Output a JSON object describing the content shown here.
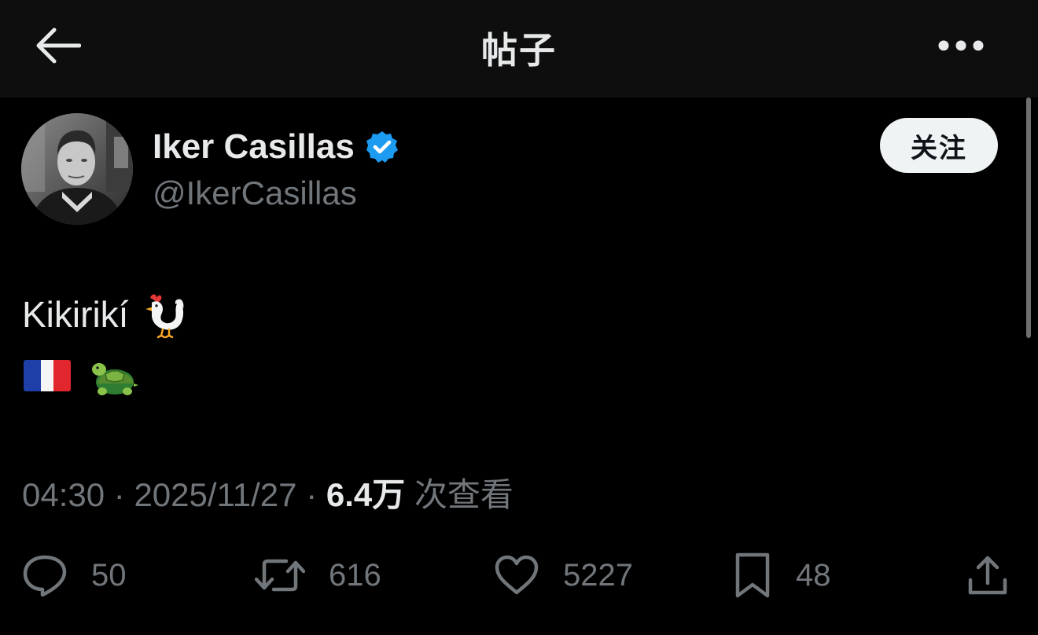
{
  "header": {
    "title": "帖子",
    "back_icon": "arrow-left-icon",
    "more_icon": "more-horizontal-icon"
  },
  "author": {
    "display_name": "Iker Casillas",
    "handle": "@IkerCasillas",
    "verified": true,
    "verified_color": "#1d9bf0",
    "follow_label": "关注"
  },
  "tweet": {
    "text": "Kikirikí",
    "emoji_line1": [
      "rooster-emoji"
    ],
    "emoji_line2": [
      "france-flag-emoji",
      "turtle-emoji"
    ]
  },
  "meta": {
    "time": "04:30",
    "separator": " · ",
    "date": "2025/11/27",
    "views_count": "6.4万",
    "views_label": " 次查看"
  },
  "actions": {
    "replies": "50",
    "retweets": "616",
    "likes": "5227",
    "bookmarks": "48",
    "share_icon": "share-icon"
  },
  "colors": {
    "background": "#000000",
    "header_background": "#0e0e0e",
    "primary_text": "#e7e9ea",
    "secondary_text": "#71767b",
    "follow_button_bg": "#eff3f4"
  }
}
